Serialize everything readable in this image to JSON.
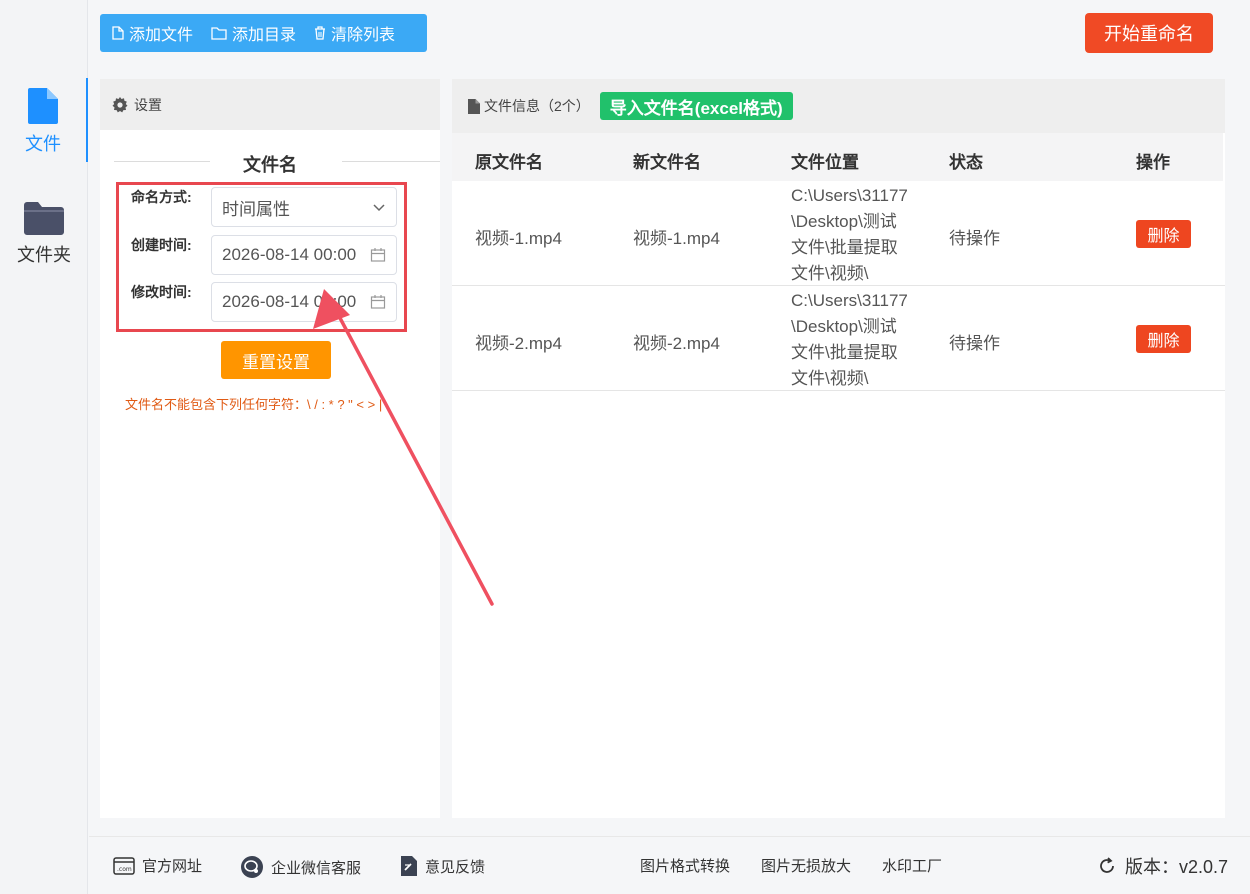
{
  "nav": {
    "file_label": "文件",
    "folder_label": "文件夹"
  },
  "toolbar": {
    "add_file": "添加文件",
    "add_dir": "添加目录",
    "clear_list": "清除列表",
    "start": "开始重命名"
  },
  "settings": {
    "title": "设置",
    "section": "文件名",
    "naming_label": "命名方式:",
    "naming_value": "时间属性",
    "create_label": "创建时间:",
    "create_value": "2026-08-14 00:00",
    "modify_label": "修改时间:",
    "modify_value": "2026-08-14 00:00",
    "reset": "重置设置",
    "warning": "文件名不能包含下列任何字符：\\ / : * ? \" < > |"
  },
  "files": {
    "title": "文件信息（2个）",
    "import_btn": "导入文件名(excel格式)",
    "columns": [
      "原文件名",
      "新文件名",
      "文件位置",
      "状态",
      "操作"
    ],
    "rows": [
      {
        "orig": "视频-1.mp4",
        "new": "视频-1.mp4",
        "path": "C:\\Users\\31177\\Desktop\\测试文件\\批量提取文件\\视频\\",
        "status": "待操作",
        "action": "删除"
      },
      {
        "orig": "视频-2.mp4",
        "new": "视频-2.mp4",
        "path": "C:\\Users\\31177\\Desktop\\测试文件\\批量提取文件\\视频\\",
        "status": "待操作",
        "action": "删除"
      }
    ]
  },
  "footer": {
    "site": "官方网址",
    "wechat": "企业微信客服",
    "feedback": "意见反馈",
    "img_convert": "图片格式转换",
    "img_enlarge": "图片无损放大",
    "watermark": "水印工厂",
    "version": "版本：v2.0.7"
  },
  "colors": {
    "accent_blue": "#3ba9f5",
    "start_red": "#f04a25",
    "import_green": "#21c16b",
    "reset_orange": "#ff9500",
    "annotation_red": "#e8474f"
  }
}
